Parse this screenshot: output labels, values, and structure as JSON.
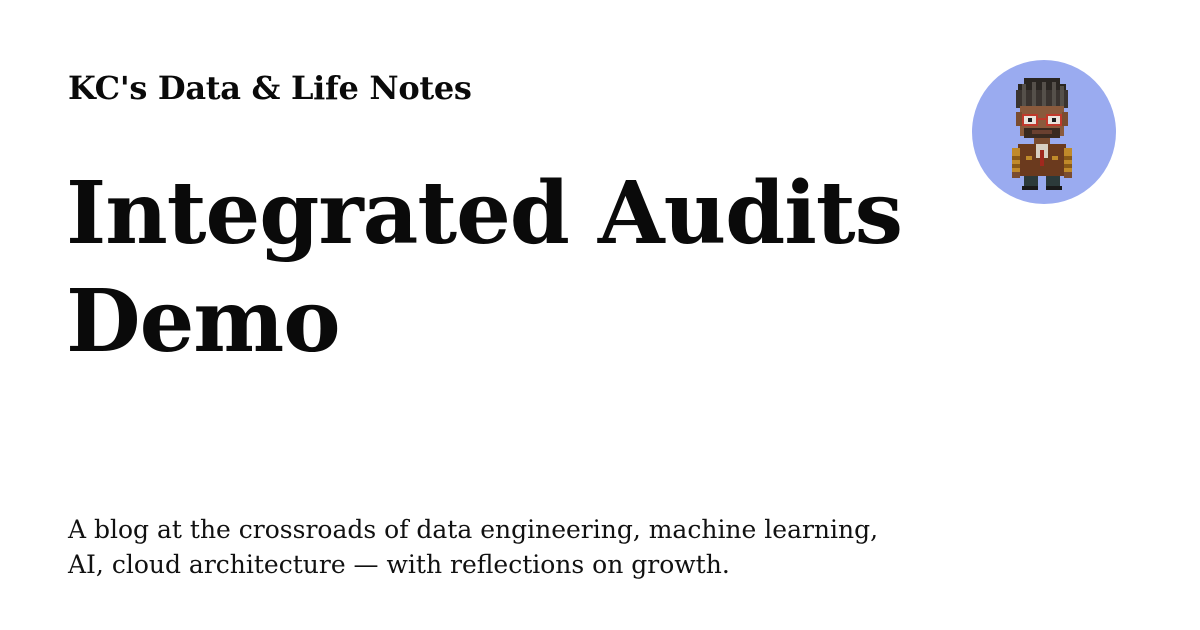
{
  "site": {
    "name": "KC's Data & Life Notes"
  },
  "post": {
    "title": "Integrated Audits Demo",
    "description": "A blog at the crossroads of data engineering, machine learning, AI, cloud architecture — with reflections on growth."
  },
  "avatar": {
    "icon": "pixel-art-character-avatar-icon",
    "background_color": "#9aabf0"
  }
}
